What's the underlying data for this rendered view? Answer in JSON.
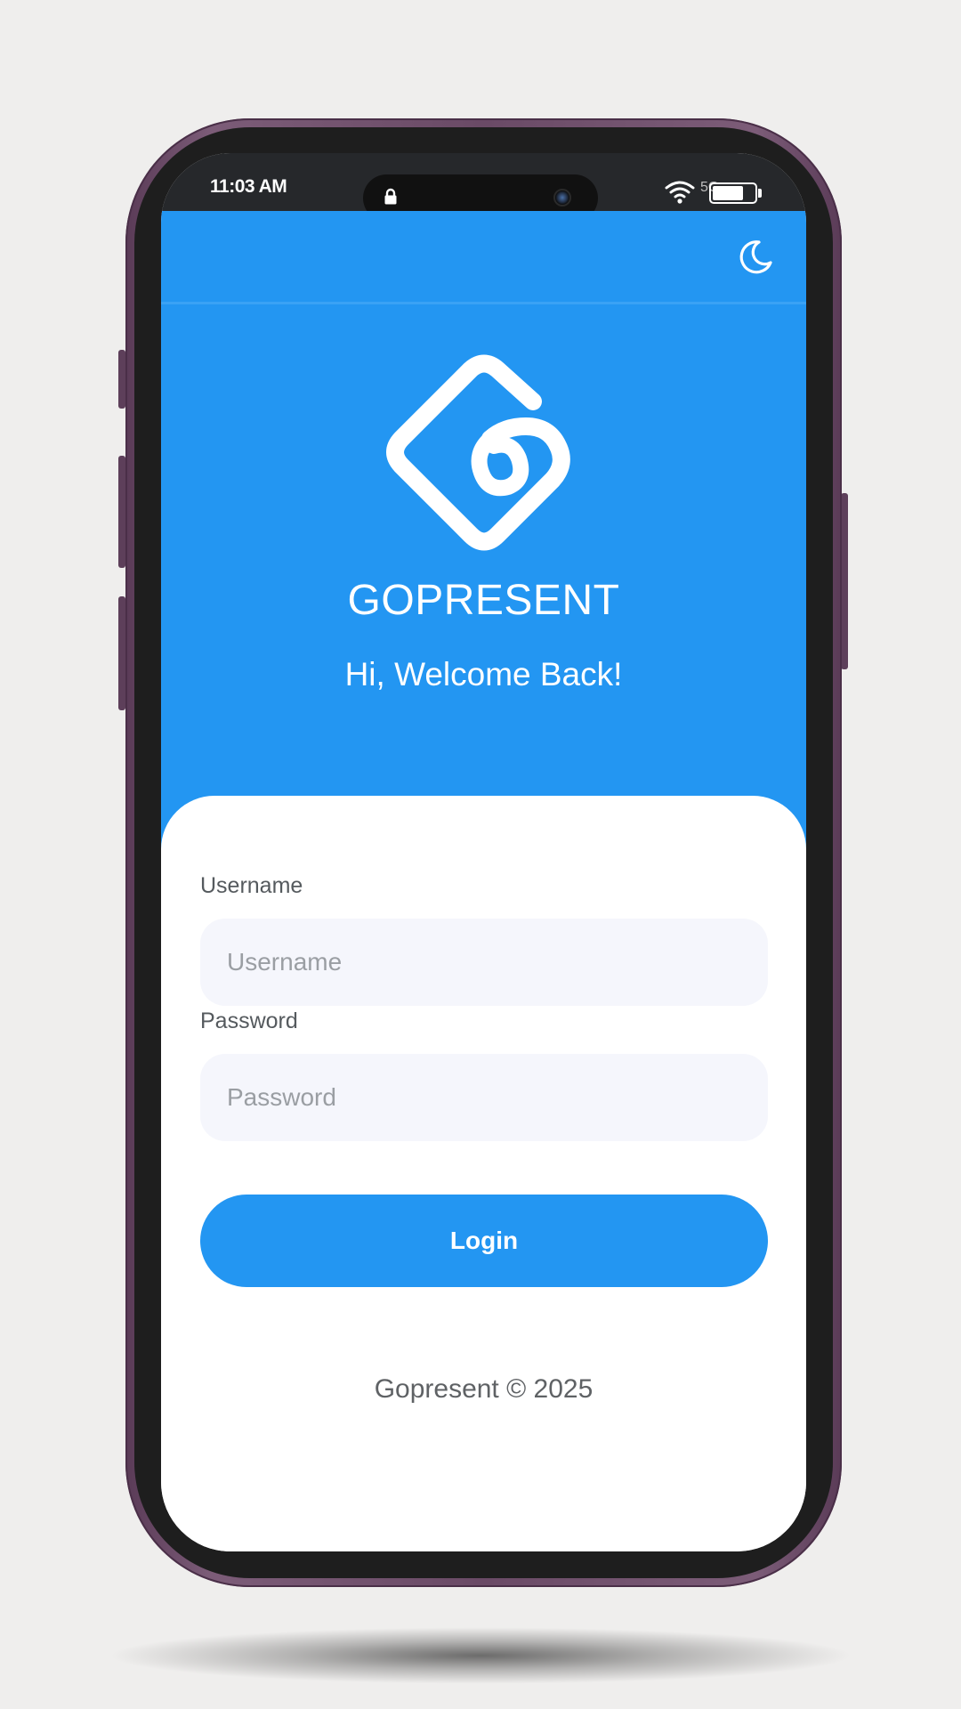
{
  "status_bar": {
    "time": "11:03 AM",
    "signal": "5G",
    "icons": [
      "lock-icon",
      "camera-icon",
      "wifi-icon",
      "battery-icon"
    ]
  },
  "header": {
    "theme_toggle_icon": "moon-icon"
  },
  "brand": {
    "logo_icon": "gopresent-logo-icon",
    "name": "GOPRESENT",
    "welcome": "Hi, Welcome Back!"
  },
  "form": {
    "username": {
      "label": "Username",
      "placeholder": "Username",
      "value": ""
    },
    "password": {
      "label": "Password",
      "placeholder": "Password",
      "value": ""
    },
    "login_label": "Login"
  },
  "footer": {
    "text": "Gopresent © 2025"
  },
  "colors": {
    "primary": "#2396f2",
    "input_bg": "#f5f6fc",
    "background": "#efeeed",
    "phone_frame": "#6a4a66"
  }
}
